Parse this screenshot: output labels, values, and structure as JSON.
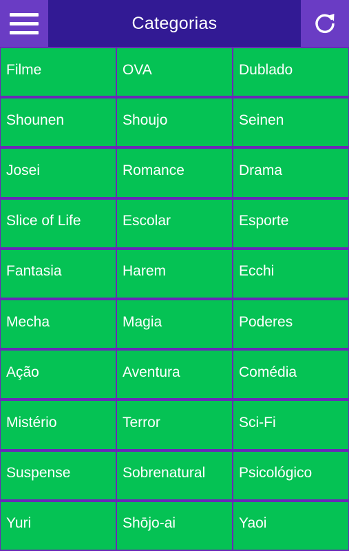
{
  "header": {
    "title": "Categorias",
    "menu_icon": "hamburger-menu-icon",
    "refresh_icon": "refresh-icon"
  },
  "colors": {
    "header_bg": "#321a94",
    "header_button_bg": "#6a3cc4",
    "tile_bg": "#05c254",
    "divider": "#6a28b8",
    "text": "#ffffff"
  },
  "categories": [
    "Filme",
    "OVA",
    "Dublado",
    "Shounen",
    "Shoujo",
    "Seinen",
    "Josei",
    "Romance",
    "Drama",
    "Slice of Life",
    "Escolar",
    "Esporte",
    "Fantasia",
    "Harem",
    "Ecchi",
    "Mecha",
    "Magia",
    "Poderes",
    "Ação",
    "Aventura",
    "Comédia",
    "Mistério",
    "Terror",
    "Sci-Fi",
    "Suspense",
    "Sobrenatural",
    "Psicológico",
    "Yuri",
    "Shōjo-ai",
    "Yaoi"
  ]
}
